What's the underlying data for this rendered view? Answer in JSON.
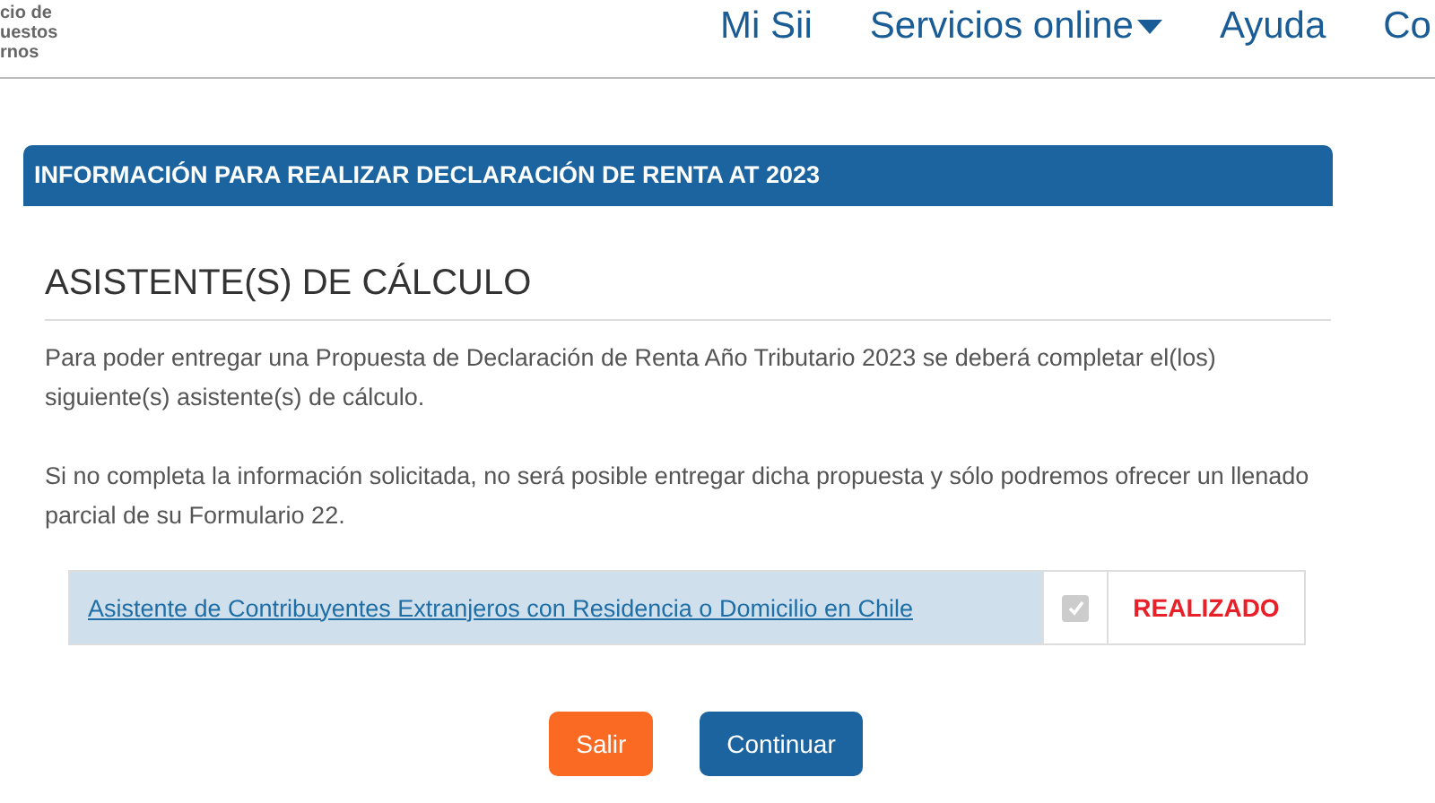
{
  "header": {
    "logo_lines": [
      "cio de",
      "uestos",
      "rnos"
    ],
    "nav": [
      {
        "label": "Mi Sii",
        "dropdown": false
      },
      {
        "label": "Servicios online",
        "dropdown": true
      },
      {
        "label": "Ayuda",
        "dropdown": false
      },
      {
        "label": "Co",
        "dropdown": false
      }
    ]
  },
  "banner": "INFORMACIÓN PARA REALIZAR DECLARACIÓN DE RENTA AT 2023",
  "heading": "ASISTENTE(S) DE CÁLCULO",
  "paragraphs": [
    "Para poder entregar una Propuesta de Declaración de Renta Año Tributario 2023 se deberá completar el(los) siguiente(s) asistente(s) de cálculo.",
    "Si no completa la información solicitada, no será posible entregar dicha propuesta y sólo podremos ofrecer un llenado parcial de su Formulario 22."
  ],
  "assistants": [
    {
      "name": "Asistente de Contribuyentes Extranjeros con Residencia o Domicilio en Chile",
      "checked": true,
      "disabled": true,
      "status": "REALIZADO",
      "color": "#e8202a"
    }
  ],
  "buttons": [
    {
      "label": "Salir",
      "kind": "secondary"
    },
    {
      "label": "Continuar",
      "kind": "primary"
    }
  ]
}
